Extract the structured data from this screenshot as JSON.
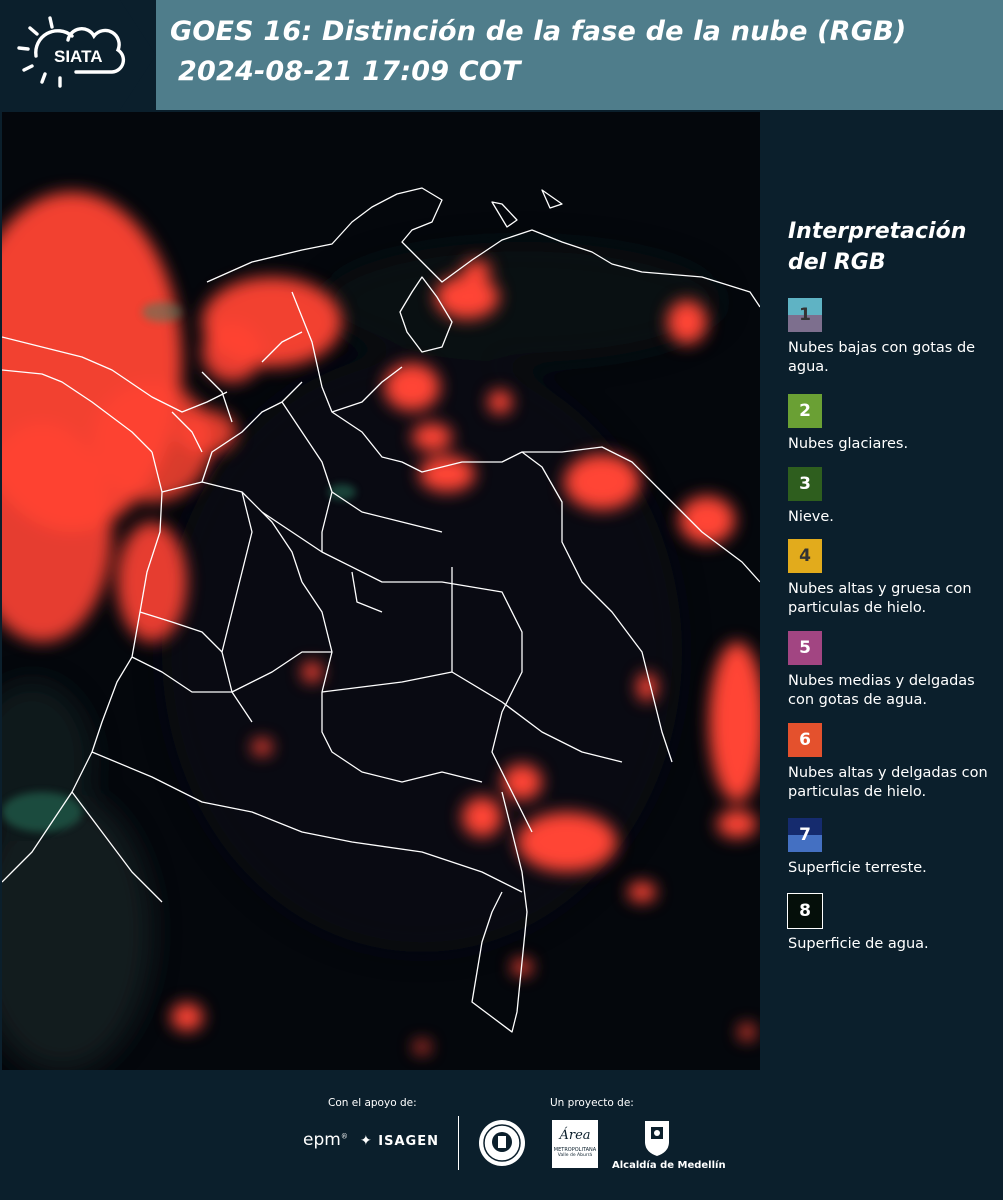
{
  "header": {
    "title_line1": "GOES 16: Distinción de la fase de la nube (RGB)",
    "title_line2": "2024-08-21 17:09 COT",
    "logo_text": "SIATA"
  },
  "legend": {
    "title_line1": "Interpretación",
    "title_line2": "del RGB",
    "items": [
      {
        "number": "1",
        "label": "Nubes bajas con gotas de agua.",
        "color_top": "#5fb3c4",
        "color_bottom": "#7d6f8e",
        "num_color": "#333333"
      },
      {
        "number": "2",
        "label": "Nubes glaciares.",
        "color_top": "#6aa034",
        "color_bottom": "#6aa034",
        "num_color": "#ffffff"
      },
      {
        "number": "3",
        "label": "Nieve.",
        "color_top": "#2e5e1e",
        "color_bottom": "#2e5e1e",
        "num_color": "#ffffff"
      },
      {
        "number": "4",
        "label": "Nubes altas y gruesa con particulas de hielo.",
        "color_top": "#e2ab1c",
        "color_bottom": "#e2ab1c",
        "num_color": "#333333"
      },
      {
        "number": "5",
        "label": "Nubes medias y delgadas con gotas de agua.",
        "color_top": "#a24582",
        "color_bottom": "#a24582",
        "num_color": "#ffffff"
      },
      {
        "number": "6",
        "label": "Nubes altas y delgadas con particulas de hielo.",
        "color_top": "#e4512d",
        "color_bottom": "#e4512d",
        "num_color": "#ffffff"
      },
      {
        "number": "7",
        "label": "Superficie terreste.",
        "color_top": "#152b6e",
        "color_bottom": "#4470c2",
        "num_color": "#ffffff"
      },
      {
        "number": "8",
        "label": "Superficie de agua.",
        "color_top": "#050f0a",
        "color_bottom": "#050f0a",
        "num_color": "#ffffff"
      }
    ]
  },
  "footer": {
    "support_label": "Con el apoyo de:",
    "project_label": "Un proyecto de:",
    "brand_epm": "epm",
    "brand_isagen": "ISAGEN",
    "brand_area_line1": "METROPOLITANA",
    "brand_area_line2": "Valle de Aburrá",
    "brand_area_script": "Área",
    "brand_alcaldia": "Alcaldía de Medellín"
  },
  "colors": {
    "background": "#0b1f2c",
    "header": "#4f7d8b",
    "cloud_red": "#ff4a3a",
    "border_line": "#ffffff"
  }
}
